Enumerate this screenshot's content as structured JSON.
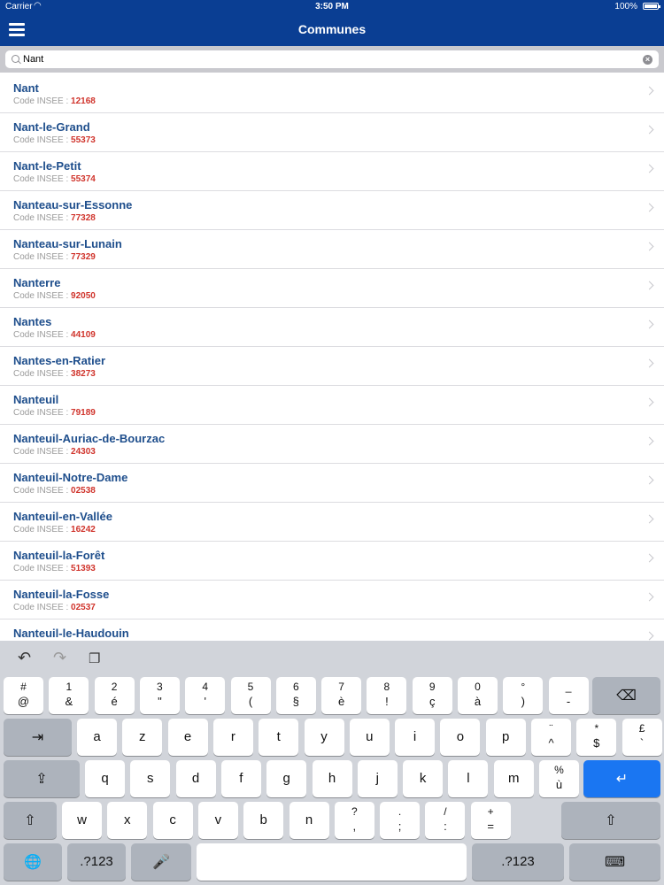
{
  "status": {
    "carrier": "Carrier",
    "time": "3:50 PM",
    "battery": "100%"
  },
  "nav": {
    "title": "Communes"
  },
  "search": {
    "value": "Nant"
  },
  "code_label": "Code INSEE : ",
  "communes": [
    {
      "name": "Nant",
      "code": "12168"
    },
    {
      "name": "Nant-le-Grand",
      "code": "55373"
    },
    {
      "name": "Nant-le-Petit",
      "code": "55374"
    },
    {
      "name": "Nanteau-sur-Essonne",
      "code": "77328"
    },
    {
      "name": "Nanteau-sur-Lunain",
      "code": "77329"
    },
    {
      "name": "Nanterre",
      "code": "92050"
    },
    {
      "name": "Nantes",
      "code": "44109"
    },
    {
      "name": "Nantes-en-Ratier",
      "code": "38273"
    },
    {
      "name": "Nanteuil",
      "code": "79189"
    },
    {
      "name": "Nanteuil-Auriac-de-Bourzac",
      "code": "24303"
    },
    {
      "name": "Nanteuil-Notre-Dame",
      "code": "02538"
    },
    {
      "name": "Nanteuil-en-Vallée",
      "code": "16242"
    },
    {
      "name": "Nanteuil-la-Forêt",
      "code": "51393"
    },
    {
      "name": "Nanteuil-la-Fosse",
      "code": "02537"
    },
    {
      "name": "Nanteuil-le-Haudouin",
      "code": ""
    }
  ],
  "keyboard": {
    "row1": [
      [
        "#",
        "@"
      ],
      [
        "1",
        "&"
      ],
      [
        "2",
        "é"
      ],
      [
        "3",
        "\""
      ],
      [
        "4",
        "'"
      ],
      [
        "5",
        "("
      ],
      [
        "6",
        "§"
      ],
      [
        "7",
        "è"
      ],
      [
        "8",
        "!"
      ],
      [
        "9",
        "ç"
      ],
      [
        "0",
        "à"
      ],
      [
        "°",
        ")"
      ],
      [
        "_",
        "-"
      ]
    ],
    "row2": [
      "a",
      "z",
      "e",
      "r",
      "t",
      "y",
      "u",
      "i",
      "o",
      "p"
    ],
    "row2_extra": [
      [
        "¨",
        "^"
      ],
      [
        "*",
        "$"
      ],
      [
        "£",
        "`"
      ]
    ],
    "row3": [
      "q",
      "s",
      "d",
      "f",
      "g",
      "h",
      "j",
      "k",
      "l",
      "m"
    ],
    "row3_extra": [
      [
        "%",
        "ù"
      ]
    ],
    "row4": [
      "w",
      "x",
      "c",
      "v",
      "b",
      "n"
    ],
    "row4_extra": [
      [
        "?",
        ","
      ],
      [
        ".",
        ";"
      ],
      [
        "/",
        ":"
      ],
      [
        "+",
        "="
      ]
    ],
    "numbers_label": ".?123"
  }
}
